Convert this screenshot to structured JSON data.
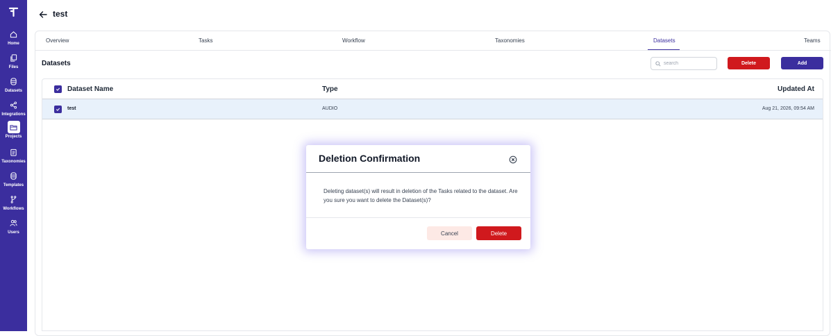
{
  "sidebar": {
    "logo": "logo-icon",
    "items": [
      {
        "label": "Home",
        "icon": "home-icon"
      },
      {
        "label": "Files",
        "icon": "files-icon"
      },
      {
        "label": "Datasets",
        "icon": "database-icon"
      },
      {
        "label": "Integrations",
        "icon": "share-icon"
      },
      {
        "label": "Projects",
        "icon": "folder-icon",
        "active": true
      },
      {
        "label": "Taxonomies",
        "icon": "clipboard-icon"
      },
      {
        "label": "Templates",
        "icon": "database-icon"
      },
      {
        "label": "Workflows",
        "icon": "branch-icon"
      },
      {
        "label": "Users",
        "icon": "users-icon"
      }
    ]
  },
  "header": {
    "title": "test"
  },
  "tabs": [
    {
      "label": "Overview"
    },
    {
      "label": "Tasks"
    },
    {
      "label": "Workflow"
    },
    {
      "label": "Taxonomies"
    },
    {
      "label": "Datasets",
      "active": true
    },
    {
      "label": "Teams"
    }
  ],
  "section": {
    "title": "Datasets"
  },
  "search": {
    "placeholder": "search",
    "value": ""
  },
  "toolbar": {
    "delete_label": "Delete",
    "add_label": "Add"
  },
  "table": {
    "columns": [
      "Dataset Name",
      "Type",
      "Updated At"
    ],
    "rows": [
      {
        "name": "test",
        "type": "AUDIO",
        "updated_at": "Aug 21, 2026, 09:54 AM",
        "checked": true
      }
    ]
  },
  "modal": {
    "title": "Deletion Confirmation",
    "body": "Deleting dataset(s) will result in deletion of the Tasks related to the dataset. Are you sure you want to delete the Dataset(s)?",
    "cancel_label": "Cancel",
    "confirm_label": "Delete"
  },
  "colors": {
    "brand": "#3b2e9e",
    "danger": "#d0191d",
    "row_highlight": "#e8f1fb",
    "cancel_bg": "#fde9e5"
  }
}
